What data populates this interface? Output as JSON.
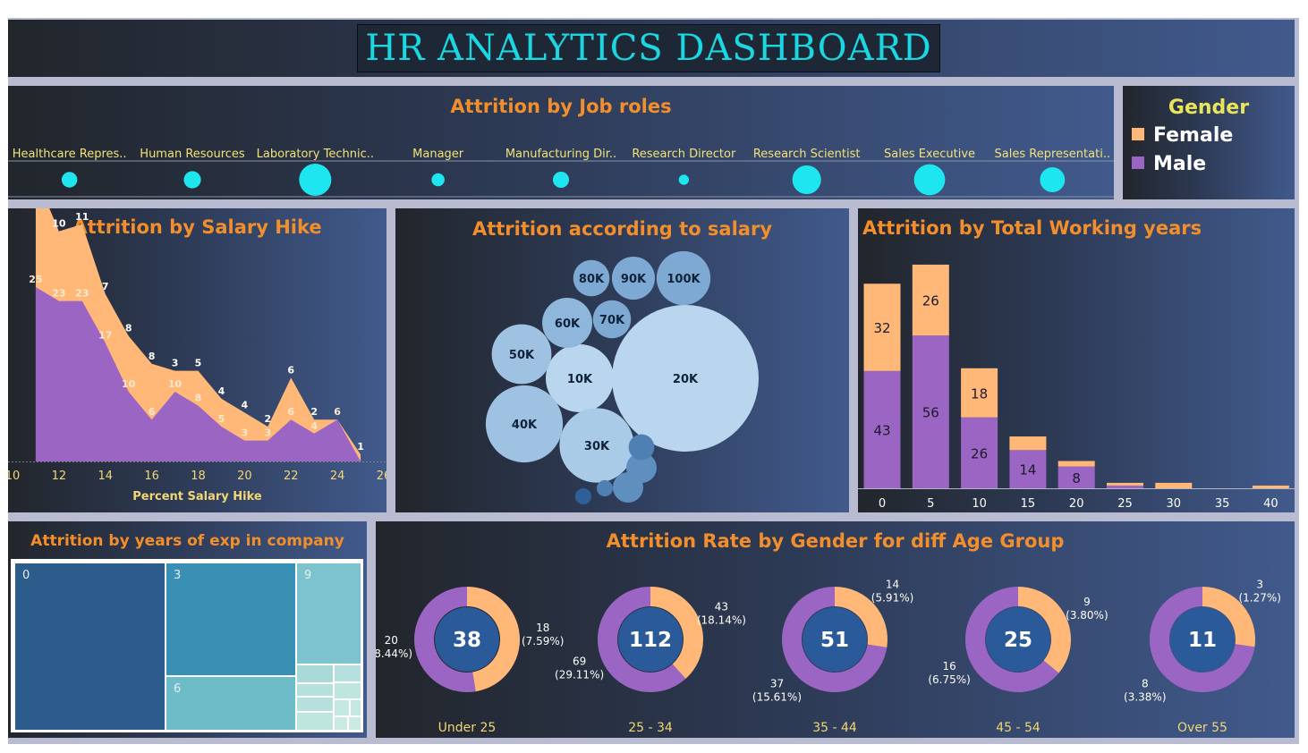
{
  "title": "HR ANALYTICS DASHBOARD",
  "colors": {
    "female": "#ffb877",
    "male": "#9b65c4",
    "accent": "#1ee6f0",
    "title_orange": "#f28e2b",
    "bubble_light": "#a9cbe8",
    "bubble_dark": "#2b5a9b"
  },
  "legend": {
    "title": "Gender",
    "items": [
      {
        "label": "Female",
        "color": "#ffb877"
      },
      {
        "label": "Male",
        "color": "#9b65c4"
      }
    ]
  },
  "chart_data": [
    {
      "id": "job_roles",
      "type": "scatter",
      "title": "Attrition by Job roles",
      "categories": [
        "Healthcare Repres..",
        "Human Resources",
        "Laboratory Technic..",
        "Manager",
        "Manufacturing Dir..",
        "Research Director",
        "Research Scientist",
        "Sales Executive",
        "Sales Representati.."
      ],
      "values": [
        9,
        12,
        62,
        5,
        10,
        2,
        47,
        57,
        33
      ]
    },
    {
      "id": "salary_hike",
      "type": "area",
      "title": "Attrition by Salary Hike",
      "xlabel": "Percent Salary Hike",
      "x": [
        11,
        12,
        13,
        14,
        15,
        16,
        17,
        18,
        19,
        20,
        21,
        22,
        23,
        24,
        25
      ],
      "xlim": [
        10,
        26
      ],
      "xticks": [
        10,
        12,
        14,
        16,
        18,
        20,
        22,
        24,
        26
      ],
      "series": [
        {
          "name": "Male",
          "values": [
            25,
            23,
            23,
            17,
            10,
            6,
            10,
            8,
            5,
            3,
            3,
            6,
            4,
            6,
            0
          ]
        },
        {
          "name": "Female",
          "values": [
            16,
            10,
            11,
            7,
            8,
            8,
            3,
            5,
            4,
            4,
            2,
            6,
            2,
            0,
            1
          ]
        }
      ]
    },
    {
      "id": "salary_bubbles",
      "type": "scatter",
      "title": "Attrition according to salary",
      "bubbles": [
        {
          "label": "20K",
          "value": 163
        },
        {
          "label": "10K",
          "value": 35
        },
        {
          "label": "30K",
          "value": 42
        },
        {
          "label": "40K",
          "value": 45
        },
        {
          "label": "50K",
          "value": 27
        },
        {
          "label": "60K",
          "value": 19
        },
        {
          "label": "70K",
          "value": 11
        },
        {
          "label": "80K",
          "value": 10
        },
        {
          "label": "90K",
          "value": 14
        },
        {
          "label": "100K",
          "value": 22
        },
        {
          "label": "",
          "value": 7
        },
        {
          "label": "",
          "value": 7
        },
        {
          "label": "",
          "value": 5
        },
        {
          "label": "",
          "value": 2
        },
        {
          "label": "",
          "value": 2
        }
      ]
    },
    {
      "id": "working_years",
      "type": "bar",
      "title": "Attrition by Total Working years",
      "categories": [
        "0",
        "5",
        "10",
        "15",
        "20",
        "25",
        "30",
        "35",
        "40"
      ],
      "series": [
        {
          "name": "Male",
          "values": [
            43,
            56,
            26,
            14,
            8,
            1,
            0,
            0,
            0
          ]
        },
        {
          "name": "Female",
          "values": [
            32,
            26,
            18,
            5,
            2,
            1,
            2,
            0,
            1
          ]
        }
      ],
      "show_label_min": 8
    },
    {
      "id": "years_in_company",
      "type": "heatmap",
      "title": "Attrition by years of exp in company",
      "labels": [
        "0",
        "3",
        "6",
        "9"
      ]
    },
    {
      "id": "gender_age",
      "type": "pie",
      "title": "Attrition Rate by Gender for diff Age Group",
      "groups": [
        {
          "label": "Under 25",
          "total": "38",
          "female": 18,
          "female_label": "18",
          "female_pct": "(7.59%)",
          "male": 20,
          "male_label": "20",
          "male_pct": "(8.44%)"
        },
        {
          "label": "25 - 34",
          "total": "112",
          "female": 43,
          "female_label": "43",
          "female_pct": "(18.14%)",
          "male": 69,
          "male_label": "69",
          "male_pct": "(29.11%)"
        },
        {
          "label": "35 - 44",
          "total": "51",
          "female": 14,
          "female_label": "14",
          "female_pct": "(5.91%)",
          "male": 37,
          "male_label": "37",
          "male_pct": "(15.61%)"
        },
        {
          "label": "45 - 54",
          "total": "25",
          "female": 9,
          "female_label": "9",
          "female_pct": "(3.80%)",
          "male": 16,
          "male_label": "16",
          "male_pct": "(6.75%)"
        },
        {
          "label": "Over 55",
          "total": "11",
          "female": 3,
          "female_label": "3",
          "female_pct": "(1.27%)",
          "male": 8,
          "male_label": "8",
          "male_pct": "(3.38%)"
        }
      ]
    }
  ]
}
